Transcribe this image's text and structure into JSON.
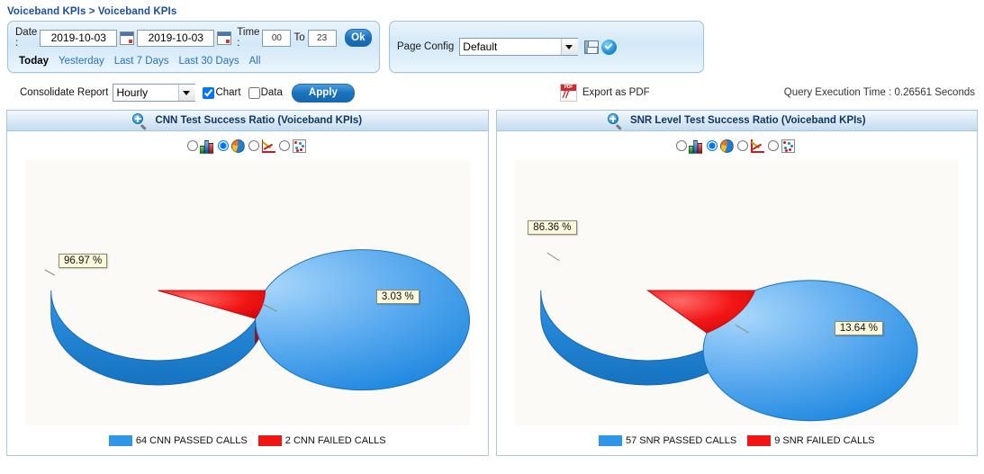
{
  "breadcrumb": "Voiceband KPIs > Voiceband KPIs",
  "filters": {
    "date_label": "Date :",
    "date_from": "2019-10-03",
    "date_to": "2019-10-03",
    "time_label": "Time :",
    "time_from": "00",
    "time_to_label": "To",
    "time_to": "23",
    "ok_label": "Ok",
    "calendar_icon": "calendar-icon",
    "quick_ranges": [
      {
        "label": "Today",
        "active": true
      },
      {
        "label": "Yesterday",
        "active": false
      },
      {
        "label": "Last 7 Days",
        "active": false
      },
      {
        "label": "Last 30 Days",
        "active": false
      },
      {
        "label": "All",
        "active": false
      }
    ]
  },
  "page_config": {
    "label": "Page Config",
    "selected": "Default",
    "options": [
      "Default"
    ],
    "save_icon": "save-icon",
    "apply_icon": "check-circle-icon"
  },
  "toolbar": {
    "consolidate_label": "Consolidate Report",
    "consolidate_selected": "Hourly",
    "consolidate_options": [
      "Hourly"
    ],
    "chart_label": "Chart",
    "chart_checked": true,
    "data_label": "Data",
    "data_checked": false,
    "apply_label": "Apply",
    "export_label": "Export as PDF",
    "export_icon": "pdf-icon",
    "query_time": "Query Execution Time : 0.26561 Seconds"
  },
  "chart_types": [
    {
      "name": "bar",
      "selected": false
    },
    {
      "name": "pie",
      "selected": true
    },
    {
      "name": "line",
      "selected": false
    },
    {
      "name": "scatter",
      "selected": false
    }
  ],
  "colors": {
    "passed": "#2e95e8",
    "failed": "#f01414",
    "passed_dark": "#1a7fd0",
    "failed_dark": "#c40d0d",
    "accent": "#1b4f9c",
    "label_bg": "#fbf8dc"
  },
  "panels": [
    {
      "id": "cnn",
      "title": "CNN Test Success Ratio (Voiceband KPIs)",
      "zoom_icon": "zoom-in-icon",
      "chart_data": {
        "type": "pie",
        "title": "CNN Test Success Ratio (Voiceband KPIs)",
        "categories": [
          "64 CNN PASSED CALLS",
          "2 CNN FAILED CALLS"
        ],
        "values": [
          64,
          2
        ],
        "percent_labels": [
          "96.97 %",
          "3.03 %"
        ],
        "percents": [
          96.97,
          3.03
        ],
        "colors": [
          "#2e95e8",
          "#f01414"
        ],
        "legend_position": "bottom",
        "three_d": true
      }
    },
    {
      "id": "snr",
      "title": "SNR Level Test Success Ratio (Voiceband KPIs)",
      "zoom_icon": "zoom-in-icon",
      "chart_data": {
        "type": "pie",
        "title": "SNR Level Test Success Ratio (Voiceband KPIs)",
        "categories": [
          "57 SNR PASSED CALLS",
          "9 SNR FAILED CALLS"
        ],
        "values": [
          57,
          9
        ],
        "percent_labels": [
          "86.36 %",
          "13.64 %"
        ],
        "percents": [
          86.36,
          13.64
        ],
        "colors": [
          "#2e95e8",
          "#f01414"
        ],
        "legend_position": "bottom",
        "three_d": true
      }
    }
  ]
}
